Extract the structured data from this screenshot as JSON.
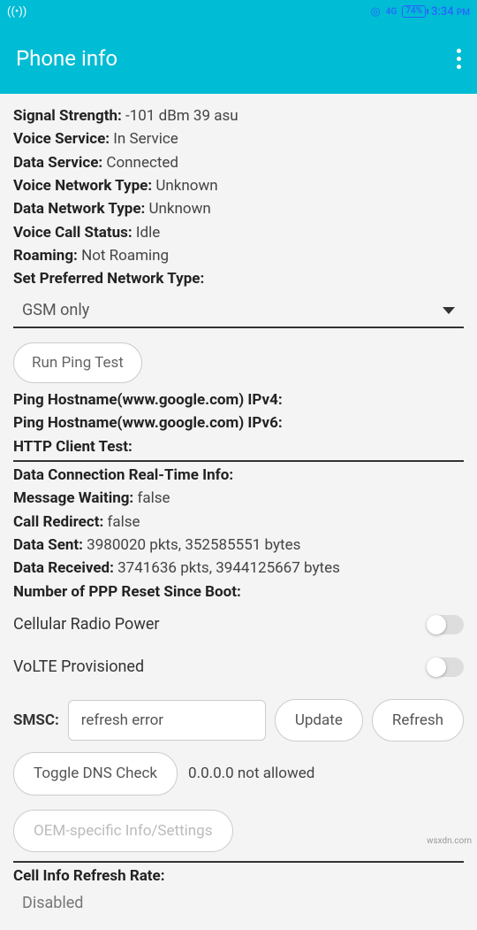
{
  "status": {
    "battery": "74%",
    "time": "3:34",
    "ampm": "PM"
  },
  "app": {
    "title": "Phone info"
  },
  "signal": {
    "label": "Signal Strength:",
    "value": "-101 dBm   39 asu"
  },
  "voice_service": {
    "label": "Voice Service:",
    "value": "In Service"
  },
  "data_service": {
    "label": "Data Service:",
    "value": "Connected"
  },
  "voice_net": {
    "label": "Voice Network Type:",
    "value": "Unknown"
  },
  "data_net": {
    "label": "Data Network Type:",
    "value": "Unknown"
  },
  "voice_call": {
    "label": "Voice Call Status:",
    "value": "Idle"
  },
  "roaming": {
    "label": "Roaming:",
    "value": "Not Roaming"
  },
  "pref_net": {
    "label": "Set Preferred Network Type:",
    "value": "GSM only"
  },
  "ping_button": "Run Ping Test",
  "ping_ipv4": "Ping Hostname(www.google.com) IPv4:",
  "ping_ipv6": "Ping Hostname(www.google.com) IPv6:",
  "http_test": "HTTP Client Test:",
  "data_rt": "Data Connection Real-Time Info:",
  "msg_wait": {
    "label": "Message Waiting:",
    "value": "false"
  },
  "call_redirect": {
    "label": "Call Redirect:",
    "value": "false"
  },
  "data_sent": {
    "label": "Data Sent:",
    "value": "3980020 pkts, 352585551 bytes"
  },
  "data_recv": {
    "label": "Data Received:",
    "value": "3741636 pkts, 3944125667 bytes"
  },
  "ppp": "Number of PPP Reset Since Boot:",
  "radio_power": "Cellular Radio Power",
  "volte": "VoLTE Provisioned",
  "smsc": {
    "label": "SMSC:",
    "value": "refresh error",
    "update": "Update",
    "refresh": "Refresh"
  },
  "dns": {
    "button": "Toggle DNS Check",
    "text": "0.0.0.0 not allowed"
  },
  "oem": "OEM-specific Info/Settings",
  "cell_rate": {
    "label": "Cell Info Refresh Rate:",
    "value": "Disabled"
  },
  "watermark": "wsxdn.com"
}
